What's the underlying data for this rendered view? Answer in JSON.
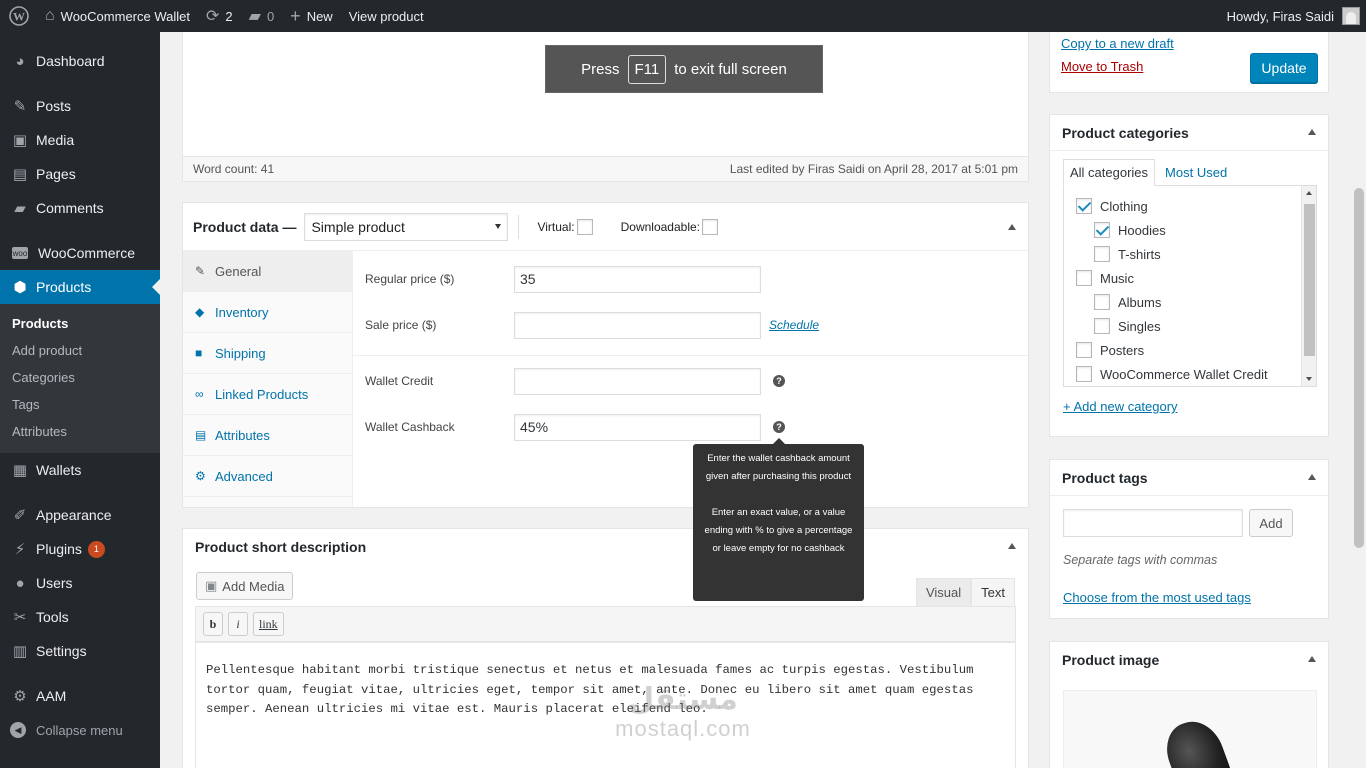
{
  "adminbar": {
    "site_name": "WooCommerce Wallet",
    "updates_count": "2",
    "comments_count": "0",
    "new_label": "New",
    "view_label": "View product",
    "howdy": "Howdy, Firas Saidi"
  },
  "sidebar": {
    "dashboard": "Dashboard",
    "posts": "Posts",
    "media": "Media",
    "pages": "Pages",
    "comments": "Comments",
    "woocommerce": "WooCommerce",
    "products": "Products",
    "products_sub": [
      "Products",
      "Add product",
      "Categories",
      "Tags",
      "Attributes"
    ],
    "wallets": "Wallets",
    "appearance": "Appearance",
    "plugins": "Plugins",
    "plugins_badge": "1",
    "users": "Users",
    "tools": "Tools",
    "settings": "Settings",
    "aam": "AAM",
    "collapse": "Collapse menu"
  },
  "editor": {
    "fs_press": "Press",
    "fs_key": "F11",
    "fs_exit": "to exit full screen",
    "word_count": "Word count: 41",
    "last_edited": "Last edited by Firas Saidi on April 28, 2017 at 5:01 pm"
  },
  "product_data": {
    "title": "Product data —",
    "type": "Simple product",
    "virtual_label": "Virtual:",
    "downloadable_label": "Downloadable:",
    "tabs": [
      "General",
      "Inventory",
      "Shipping",
      "Linked Products",
      "Attributes",
      "Advanced"
    ],
    "regular_price_label": "Regular price ($)",
    "regular_price_value": "35",
    "sale_price_label": "Sale price ($)",
    "sale_price_value": "",
    "schedule": "Schedule",
    "wallet_credit_label": "Wallet Credit",
    "wallet_credit_value": "",
    "wallet_cashback_label": "Wallet Cashback",
    "wallet_cashback_value": "45%",
    "help_glyph": "?",
    "tooltip_p1": "Enter the wallet cashback amount given after purchasing this product",
    "tooltip_p2": "Enter an exact value, or a value ending with % to give a percentage or leave empty for no cashback"
  },
  "short_desc": {
    "title": "Product short description",
    "add_media": "Add Media",
    "visual_tab": "Visual",
    "text_tab": "Text",
    "qt_bold": "b",
    "qt_italic": "i",
    "qt_link": "link",
    "content": "Pellentesque habitant morbi tristique senectus et netus et malesuada fames ac turpis egestas. Vestibulum tortor quam, feugiat vitae, ultricies eget, tempor sit amet, ante. Donec eu libero sit amet quam egestas semper. Aenean ultricies mi vitae est. Mauris placerat eleifend leo."
  },
  "watermark": {
    "logo": "مستقل",
    "url": "mostaql.com"
  },
  "publish": {
    "copy_draft": "Copy to a new draft",
    "move_trash": "Move to Trash",
    "update": "Update"
  },
  "categories": {
    "title": "Product categories",
    "tab_all": "All categories",
    "tab_most_used": "Most Used",
    "items": [
      {
        "label": "Clothing",
        "checked": true,
        "level": 0
      },
      {
        "label": "Hoodies",
        "checked": true,
        "level": 1
      },
      {
        "label": "T-shirts",
        "checked": false,
        "level": 1
      },
      {
        "label": "Music",
        "checked": false,
        "level": 0
      },
      {
        "label": "Albums",
        "checked": false,
        "level": 1
      },
      {
        "label": "Singles",
        "checked": false,
        "level": 1
      },
      {
        "label": "Posters",
        "checked": false,
        "level": 0
      },
      {
        "label": "WooCommerce Wallet Credit",
        "checked": false,
        "level": 0
      }
    ],
    "add_new": "+ Add new category"
  },
  "tags": {
    "title": "Product tags",
    "add": "Add",
    "hint": "Separate tags with commas",
    "choose": "Choose from the most used tags"
  },
  "product_image": {
    "title": "Product image"
  },
  "colors": {
    "admin_dark": "#23282d",
    "accent": "#0073aa",
    "update_button": "#0085ba",
    "trash": "#aa0000",
    "badge": "#ca4a1f"
  }
}
